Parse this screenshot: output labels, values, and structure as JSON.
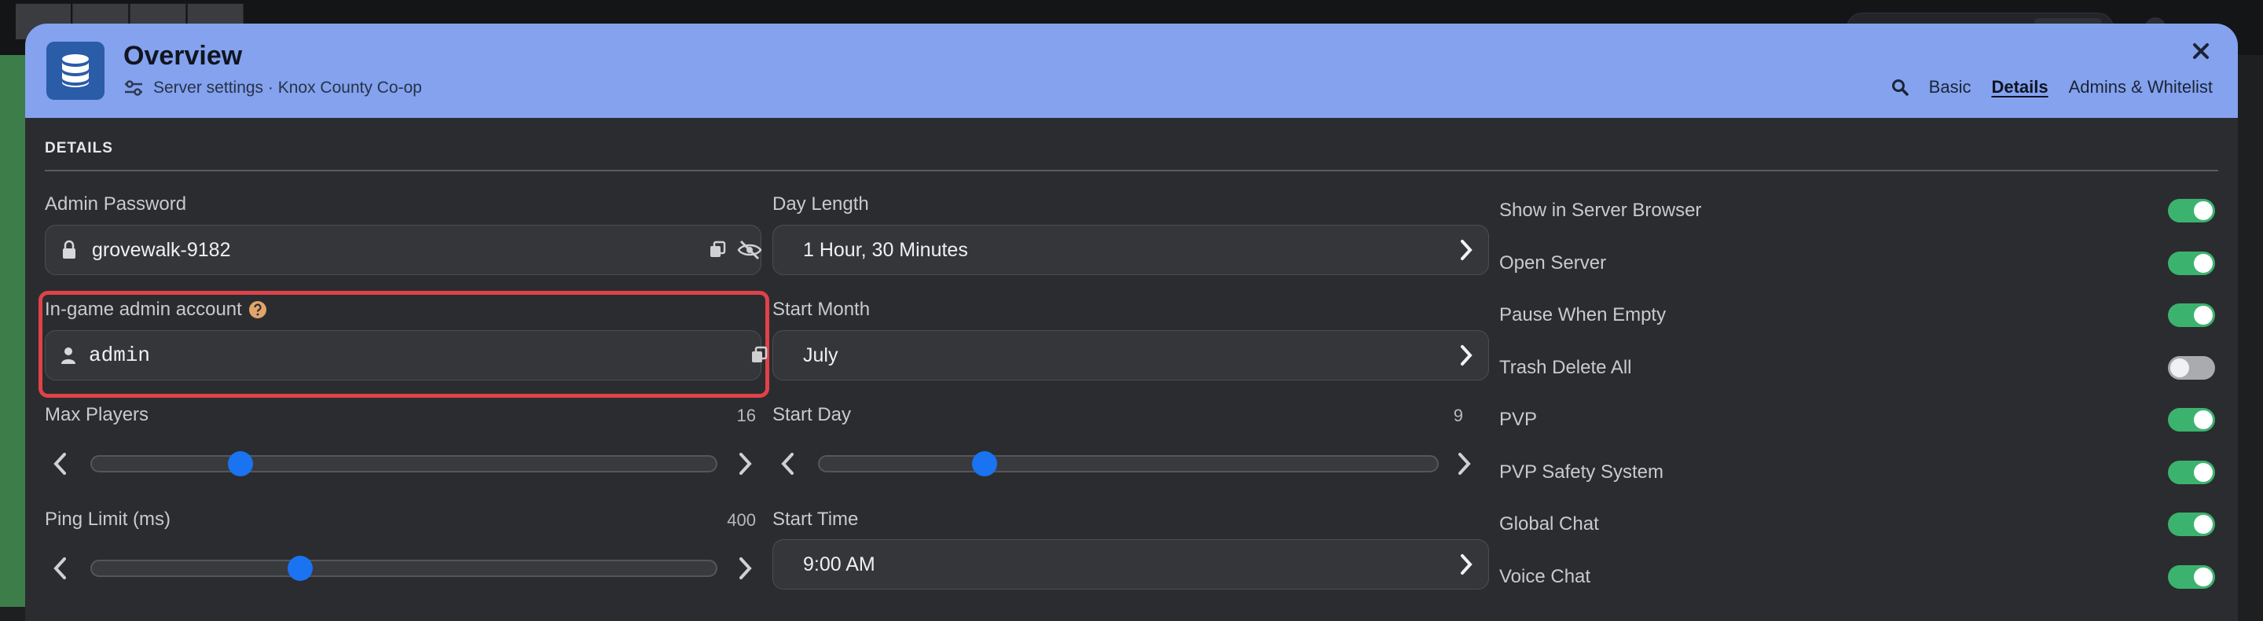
{
  "header": {
    "title": "Overview",
    "subtitle": "Server settings · Knox County Co-op",
    "icon": "database-icon",
    "nav": [
      {
        "label": "Basic",
        "active": false
      },
      {
        "label": "Details",
        "active": true
      },
      {
        "label": "Admins & Whitelist",
        "active": false
      }
    ],
    "colors": {
      "header_bg": "#84a2ee",
      "accent": "#1a73f0",
      "toggle_on": "#3bb36f",
      "highlight": "#e0424a"
    }
  },
  "section": {
    "title": "DETAILS"
  },
  "left": {
    "admin_password": {
      "label": "Admin Password",
      "value": "grovewalk-9182"
    },
    "admin_account": {
      "label": "In-game admin account",
      "value": "admin"
    },
    "max_players": {
      "label": "Max Players",
      "value": "16",
      "min": 1,
      "max": 64,
      "current": 16
    },
    "ping_limit": {
      "label": "Ping Limit (ms)",
      "value": "400",
      "min": 100,
      "max": 1000,
      "current": 400
    }
  },
  "middle": {
    "day_length": {
      "label": "Day Length",
      "value": "1 Hour, 30 Minutes"
    },
    "start_month": {
      "label": "Start Month",
      "value": "July"
    },
    "start_day": {
      "label": "Start Day",
      "value": "9",
      "min": 1,
      "max": 31,
      "current": 9
    },
    "start_time": {
      "label": "Start Time",
      "value": "9:00 AM"
    }
  },
  "toggles": [
    {
      "label": "Show in Server Browser",
      "on": true
    },
    {
      "label": "Open Server",
      "on": true
    },
    {
      "label": "Pause When Empty",
      "on": true
    },
    {
      "label": "Trash Delete All",
      "on": false
    },
    {
      "label": "PVP",
      "on": true
    },
    {
      "label": "PVP Safety System",
      "on": true
    },
    {
      "label": "Global Chat",
      "on": true
    },
    {
      "label": "Voice Chat",
      "on": true
    }
  ]
}
